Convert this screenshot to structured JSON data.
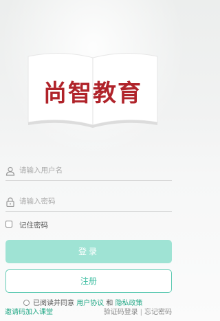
{
  "brand": {
    "logo_text": "尚智教育"
  },
  "form": {
    "username_placeholder": "请输入用户名",
    "password_placeholder": "请输入密码",
    "remember_label": "记住密码",
    "login_label": "登录",
    "register_label": "注册"
  },
  "agreement": {
    "prefix": "已阅读并同意",
    "user_agreement": "用户协议",
    "and": "和",
    "privacy_policy": "隐私政策"
  },
  "footer": {
    "invite_join": "邀请码加入课堂",
    "sms_login": "验证码登录",
    "separator": "|",
    "forgot_password": "忘记密码"
  },
  "colors": {
    "accent": "#22a886",
    "login_button": "#9fe3d4",
    "logo_red": "#b0232a"
  },
  "icons": {
    "user": "user-icon",
    "lock": "lock-icon"
  }
}
